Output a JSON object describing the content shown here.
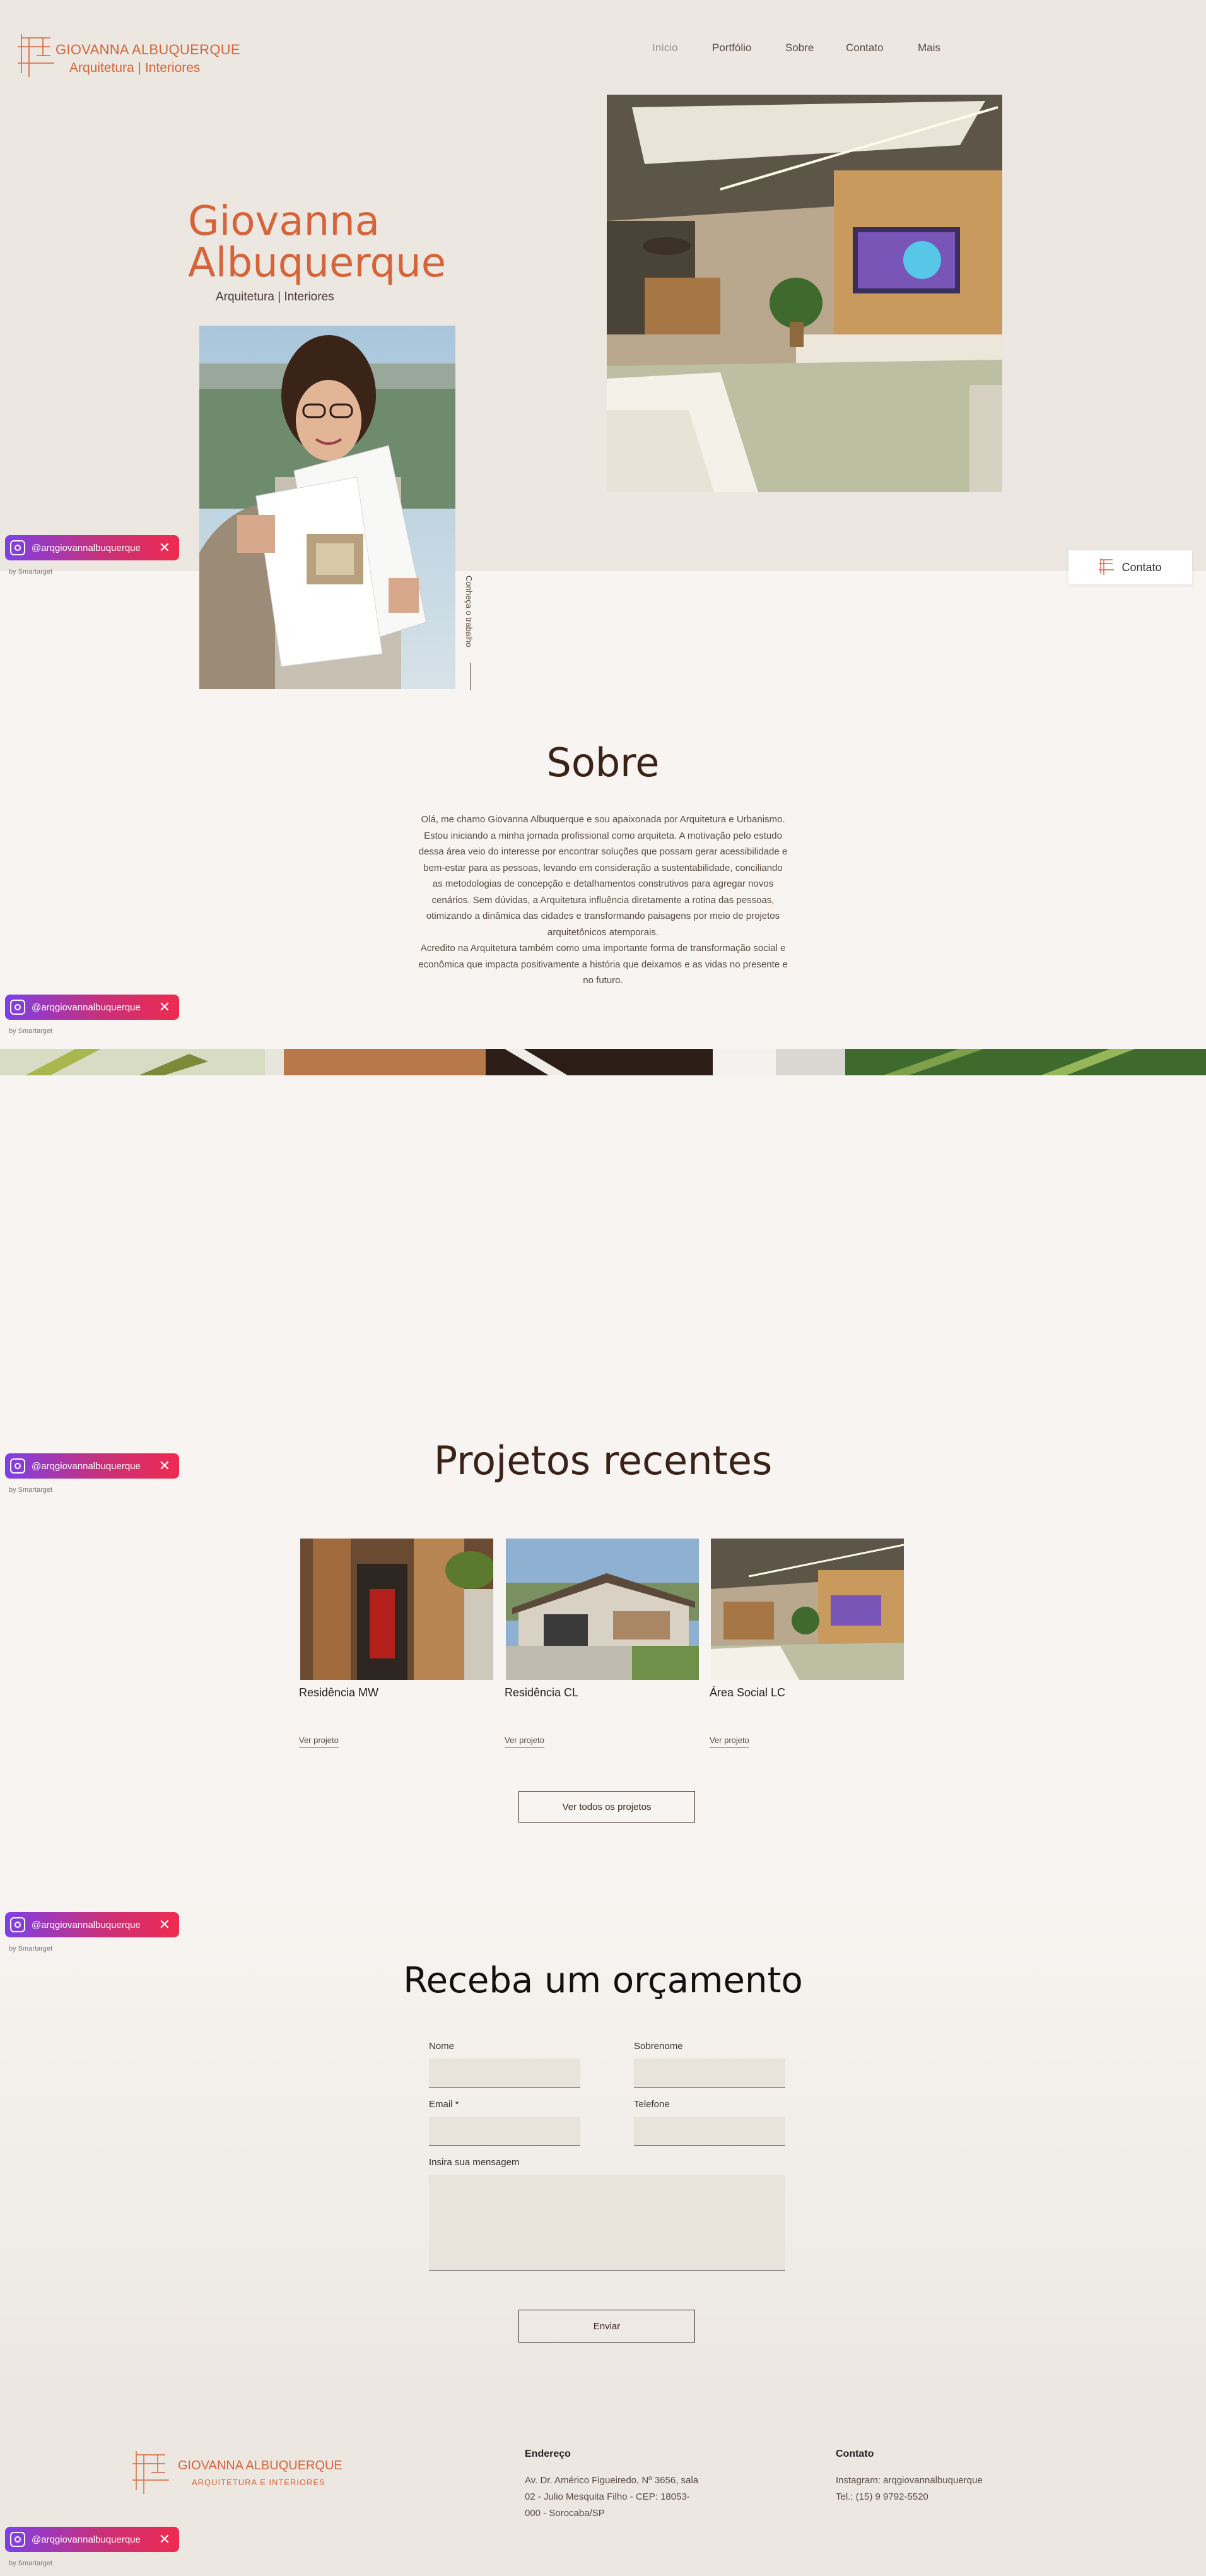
{
  "brand": {
    "name": "GIOVANNA ALBUQUERQUE",
    "tagline": "Arquitetura | Interiores",
    "footer_tagline": "ARQUITETURA E INTERIORES"
  },
  "nav": {
    "items": [
      {
        "label": "Início",
        "active": true
      },
      {
        "label": "Portfólio"
      },
      {
        "label": "Sobre"
      },
      {
        "label": "Contato"
      },
      {
        "label": "Mais"
      }
    ]
  },
  "hero": {
    "name_line1": "Giovanna",
    "name_line2": "Albuquerque",
    "role": "Arquitetura | Interiores",
    "cta_vertical": "Conheça o trabalho"
  },
  "contact_float": {
    "label": "Contato"
  },
  "instagram_widget": {
    "handle": "@arqgiovannalbuquerque",
    "credit": "by Smartarget"
  },
  "sobre": {
    "title": "Sobre",
    "paragraph1": "Olá, me chamo Giovanna Albuquerque e sou apaixonada por Arquitetura e Urbanismo. Estou iniciando a minha jornada profissional como arquiteta. A motivação pelo estudo dessa área veio do interesse por encontrar soluções que possam gerar acessibilidade e bem-estar para as pessoas, levando em consideração a sustentabilidade, conciliando as metodologias de concepção e detalhamentos construtivos para agregar novos cenários. Sem dúvidas, a Arquitetura influência diretamente a rotina das pessoas, otimizando a dinâmica das cidades e transformando paisagens por meio de projetos arquitetônicos atemporais.",
    "paragraph2": "Acredito na Arquitetura também como uma importante forma de transformação social e econômica que impacta positivamente a história que deixamos e as vidas no presente e no futuro."
  },
  "projetos": {
    "title": "Projetos recentes",
    "items": [
      {
        "name": "Residência MW",
        "link": "Ver projeto"
      },
      {
        "name": "Residência CL",
        "link": "Ver projeto"
      },
      {
        "name": "Área Social LC",
        "link": "Ver projeto"
      }
    ],
    "view_all": "Ver todos os projetos"
  },
  "orcamento": {
    "title": "Receba um orçamento",
    "fields": {
      "nome": "Nome",
      "sobrenome": "Sobrenome",
      "email": "Email *",
      "telefone": "Telefone",
      "mensagem": "Insira sua mensagem"
    },
    "submit": "Enviar"
  },
  "footer": {
    "endereco_title": "Endereço",
    "endereco_lines": [
      "Av. Dr. Américo Figueiredo, Nº 3656, sala",
      "02 - Julio Mesquita Filho - CEP: 18053-",
      "000 - Sorocaba/SP"
    ],
    "contato_title": "Contato",
    "contato_lines": [
      "Instagram: arqgiovannalbuquerque",
      "Tel.: (15) 9 9792-5520"
    ]
  },
  "colors": {
    "accent": "#d6643a",
    "brown": "#3b2218",
    "hero_bg": "#ece8e1",
    "page_bg": "#f7f4f1"
  }
}
